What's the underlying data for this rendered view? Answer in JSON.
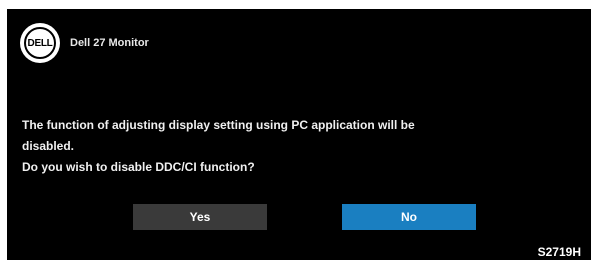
{
  "header": {
    "logo_text": "DELL",
    "title": "Dell 27 Monitor"
  },
  "message": {
    "line1": "The function of adjusting display setting using PC application will be",
    "line2": "disabled.",
    "line3": "Do you wish to disable DDC/CI function?"
  },
  "buttons": {
    "yes_label": "Yes",
    "no_label": "No"
  },
  "model": "S2719H",
  "colors": {
    "background": "#000000",
    "yes_button": "#3a3a3a",
    "no_button": "#1a7fc1"
  }
}
